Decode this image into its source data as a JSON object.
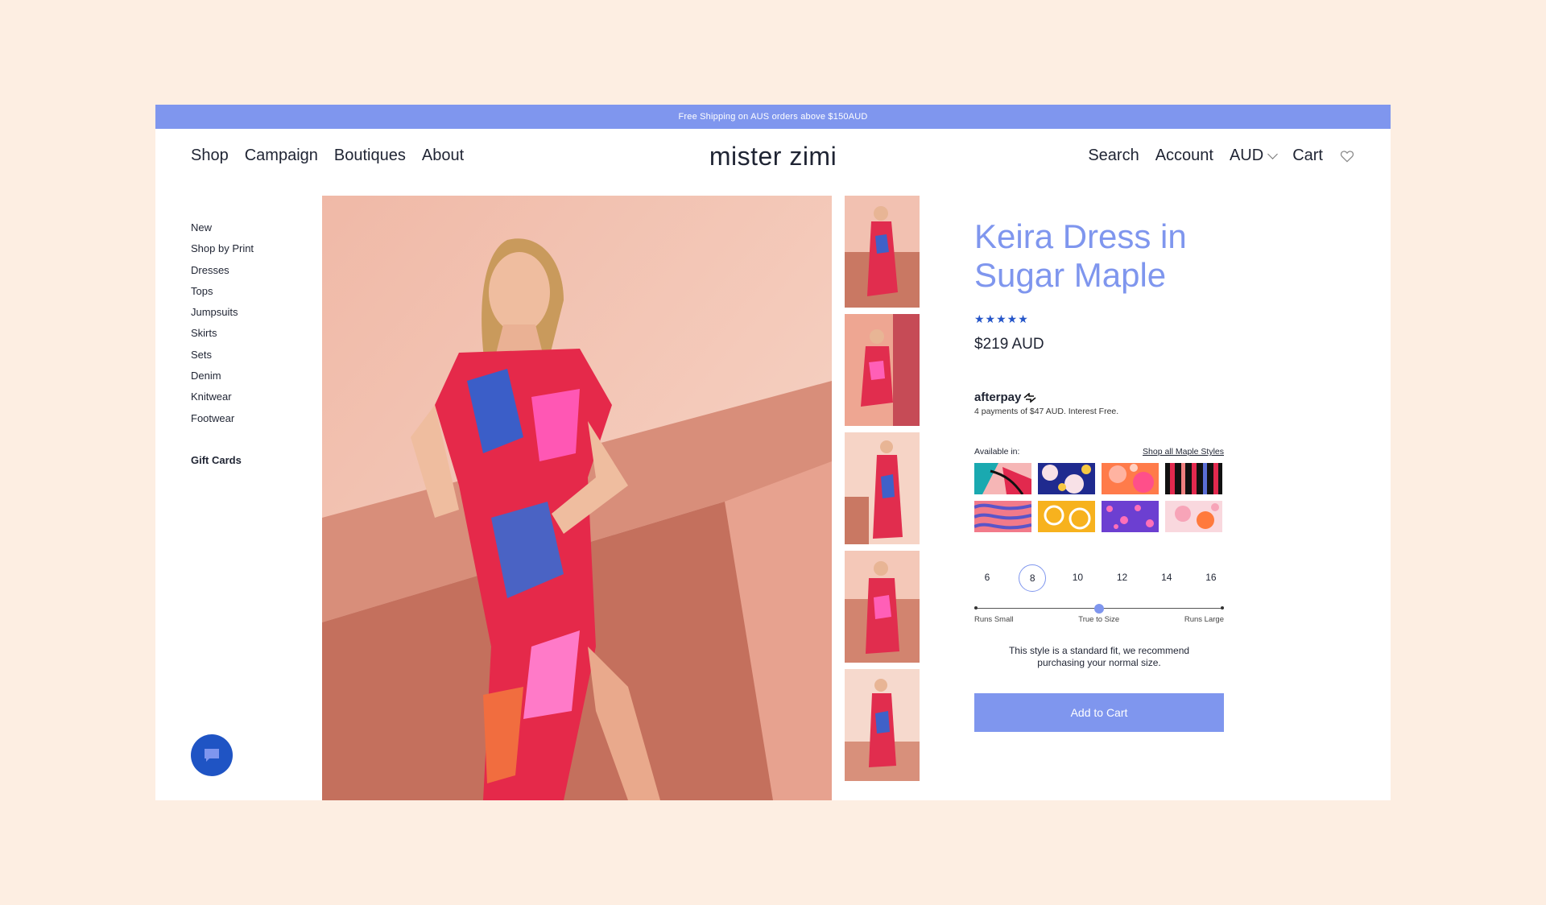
{
  "promo": {
    "text": "Free Shipping on AUS orders above $150AUD"
  },
  "nav": {
    "left": [
      "Shop",
      "Campaign",
      "Boutiques",
      "About"
    ],
    "logo": "mister zimi",
    "search": "Search",
    "account": "Account",
    "currency": "AUD",
    "cart": "Cart"
  },
  "sidebar": {
    "categories": [
      "New",
      "Shop by Print",
      "Dresses",
      "Tops",
      "Jumpsuits",
      "Skirts",
      "Sets",
      "Denim",
      "Knitwear",
      "Footwear"
    ],
    "gift_cards": "Gift Cards"
  },
  "product": {
    "title_line1": "Keira Dress in",
    "title_line2": "Sugar Maple",
    "stars": "★★★★★",
    "rating": 5,
    "price": "$219 AUD",
    "afterpay_brand": "afterpay",
    "afterpay_note": "4 payments of $47 AUD. Interest Free.",
    "available_label": "Available in:",
    "shop_all_link": "Shop all Maple Styles",
    "sizes": [
      "6",
      "8",
      "10",
      "12",
      "14",
      "16"
    ],
    "selected_size": "8",
    "fit_labels": [
      "Runs Small",
      "True to Size",
      "Runs Large"
    ],
    "fit_value": 0.5,
    "fit_note": "This style is a standard fit, we recommend purchasing your normal size.",
    "add_to_cart": "Add to Cart"
  },
  "colors": {
    "accent": "#7f96ee",
    "chat": "#1f54c4",
    "stars": "#2555c8",
    "page_bg": "#fdeee2"
  }
}
